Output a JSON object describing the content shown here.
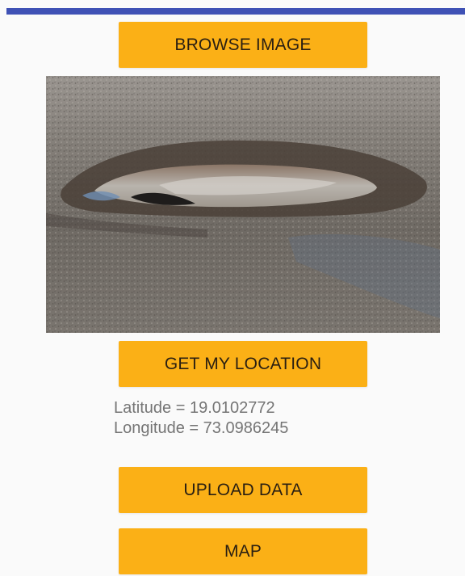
{
  "app": {
    "accent_color": "#3f51b5",
    "button_color": "#fbb016"
  },
  "buttons": {
    "browse_label": "BROWSE IMAGE",
    "location_label": "GET MY LOCATION",
    "upload_label": "UPLOAD DATA",
    "map_label": "MAP"
  },
  "location": {
    "latitude_text": "Latitude = 19.0102772",
    "longitude_text": "Longitude = 73.0986245"
  },
  "image": {
    "subject": "pothole-photo"
  }
}
